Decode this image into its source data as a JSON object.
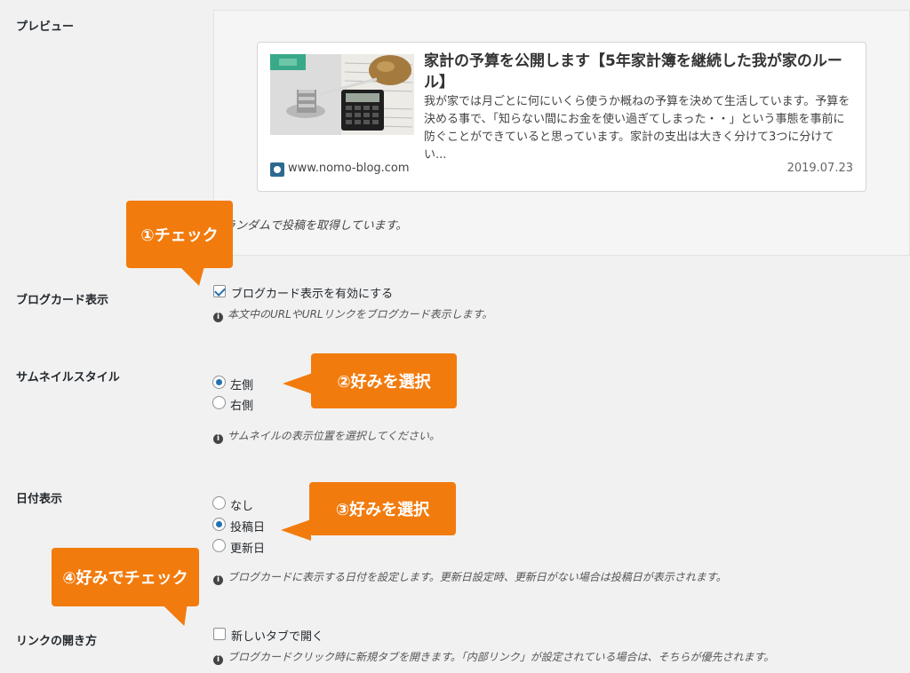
{
  "labels": {
    "preview": "プレビュー",
    "blogcard": "ブログカード表示",
    "thumb_style": "サムネイルスタイル",
    "date": "日付表示",
    "link": "リンクの開き方"
  },
  "preview": {
    "title": "家計の予算を公開します【5年家計簿を継続した我が家のルール】",
    "excerpt": "我が家では月ごとに何にいくら使うか概ねの予算を決めて生活しています。予算を決める事で、「知らない間にお金を使い過ぎてしまった・・」という事態を事前に防ぐことができていると思っています。家計の支出は大きく分けて3つに分けてい...",
    "site": "www.nomo-blog.com",
    "date": "2019.07.23",
    "note": "ランダムで投稿を取得しています。"
  },
  "blogcard": {
    "checkbox_label": "ブログカード表示を有効にする",
    "checked": true,
    "help": "本文中のURLやURLリンクをブログカード表示します。"
  },
  "thumb_style": {
    "options": [
      "左側",
      "右側"
    ],
    "selected": "左側",
    "help": "サムネイルの表示位置を選択してください。"
  },
  "date": {
    "options": [
      "なし",
      "投稿日",
      "更新日"
    ],
    "selected": "投稿日",
    "help": "ブログカードに表示する日付を設定します。更新日設定時、更新日がない場合は投稿日が表示されます。"
  },
  "link": {
    "checkbox_label": "新しいタブで開く",
    "checked": false,
    "help": "ブログカードクリック時に新規タブを開きます。「内部リンク」が設定されている場合は、そちらが優先されます。"
  },
  "callouts": {
    "c1": "①チェック",
    "c2": "②好みを選択",
    "c3": "③好みを選択",
    "c4": "④好みでチェック"
  },
  "colors": {
    "callout": "#f27b0e",
    "accent": "#2271b1",
    "favicon": "#2d6a8f"
  },
  "icons": {
    "info": "info-icon",
    "favicon": "site-favicon-icon"
  }
}
